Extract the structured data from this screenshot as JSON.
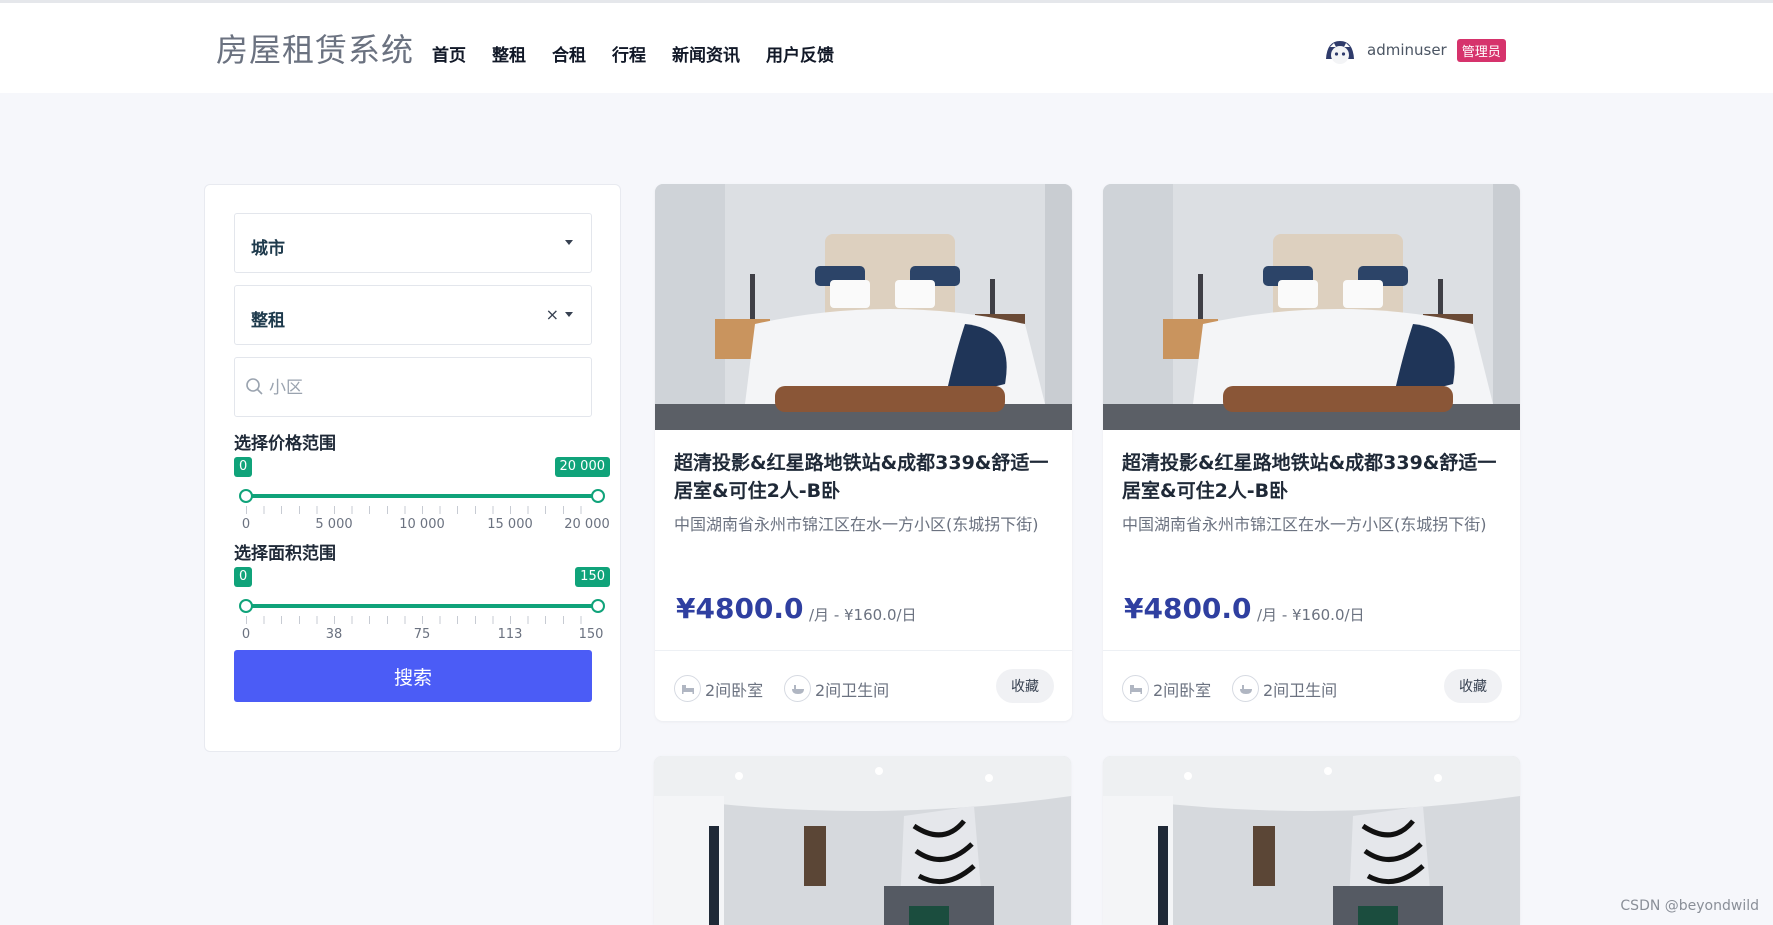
{
  "header": {
    "brand": "房屋租赁系统",
    "nav": [
      "首页",
      "整租",
      "合租",
      "行程",
      "新闻资讯",
      "用户反馈"
    ],
    "username": "adminuser",
    "role_badge": "管理员"
  },
  "filter": {
    "city_select": "城市",
    "type_select": "整租",
    "community_placeholder": "小区",
    "price": {
      "title": "选择价格范围",
      "min_label": "0",
      "max_label": "20 000",
      "min_value": 0,
      "max_value": 20000,
      "scale": [
        "0",
        "5 000",
        "10 000",
        "15 000",
        "20 000"
      ]
    },
    "area": {
      "title": "选择面积范围",
      "min_label": "0",
      "max_label": "150",
      "min_value": 0,
      "max_value": 150,
      "scale": [
        "0",
        "38",
        "75",
        "113",
        "150"
      ]
    },
    "search_button": "搜索"
  },
  "listings": [
    {
      "title": "超清投影&红星路地铁站&成都339&舒适一居室&可住2人-B卧",
      "address": "中国湖南省永州市锦江区在水一方小区(东城拐下街)",
      "price": "¥4800.0",
      "per": "/月 -  ¥160.0/日",
      "bedrooms": "2间卧室",
      "bathrooms": "2间卫生间",
      "fav": "收藏"
    },
    {
      "title": "超清投影&红星路地铁站&成都339&舒适一居室&可住2人-B卧",
      "address": "中国湖南省永州市锦江区在水一方小区(东城拐下街)",
      "price": "¥4800.0",
      "per": "/月 -  ¥160.0/日",
      "bedrooms": "2间卧室",
      "bathrooms": "2间卫生间",
      "fav": "收藏"
    }
  ],
  "watermark": "CSDN @beyondwild"
}
